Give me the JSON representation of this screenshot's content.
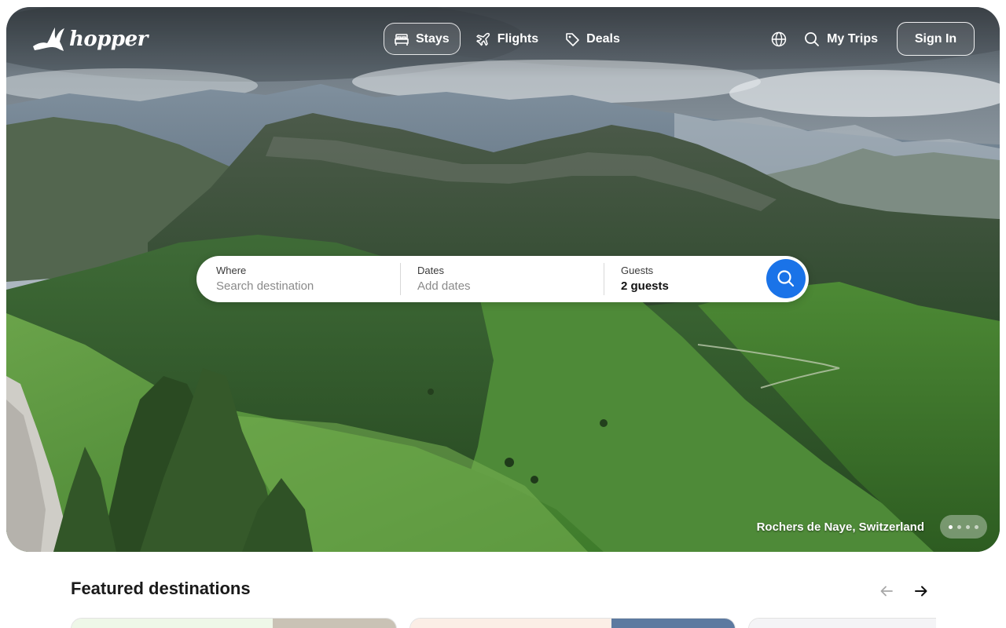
{
  "brand": {
    "name": "hopper"
  },
  "nav": {
    "tabs": [
      {
        "label": "Stays",
        "icon": "bed-icon",
        "active": true
      },
      {
        "label": "Flights",
        "icon": "plane-icon",
        "active": false
      },
      {
        "label": "Deals",
        "icon": "tag-icon",
        "active": false
      }
    ],
    "language_icon": "globe-icon",
    "my_trips": "My Trips",
    "sign_in": "Sign In"
  },
  "search": {
    "where": {
      "label": "Where",
      "placeholder": "Search destination"
    },
    "dates": {
      "label": "Dates",
      "placeholder": "Add dates"
    },
    "guests": {
      "label": "Guests",
      "value": "2 guests"
    },
    "button_icon": "search-icon"
  },
  "hero": {
    "caption": "Rochers de Naye, Switzerland",
    "slides": 4,
    "active_slide": 1
  },
  "featured": {
    "title": "Featured destinations",
    "cards": [
      {
        "left_color": "#eef7e8",
        "right_color": "#c9c2b5"
      },
      {
        "left_color": "#fbeee6",
        "right_color": "#5d7aa0"
      },
      {
        "left_color": "#f4f4f6",
        "right_color": "#e8e8ec"
      }
    ]
  },
  "colors": {
    "accent": "#1a73e8",
    "text": "#1a1a1a"
  }
}
